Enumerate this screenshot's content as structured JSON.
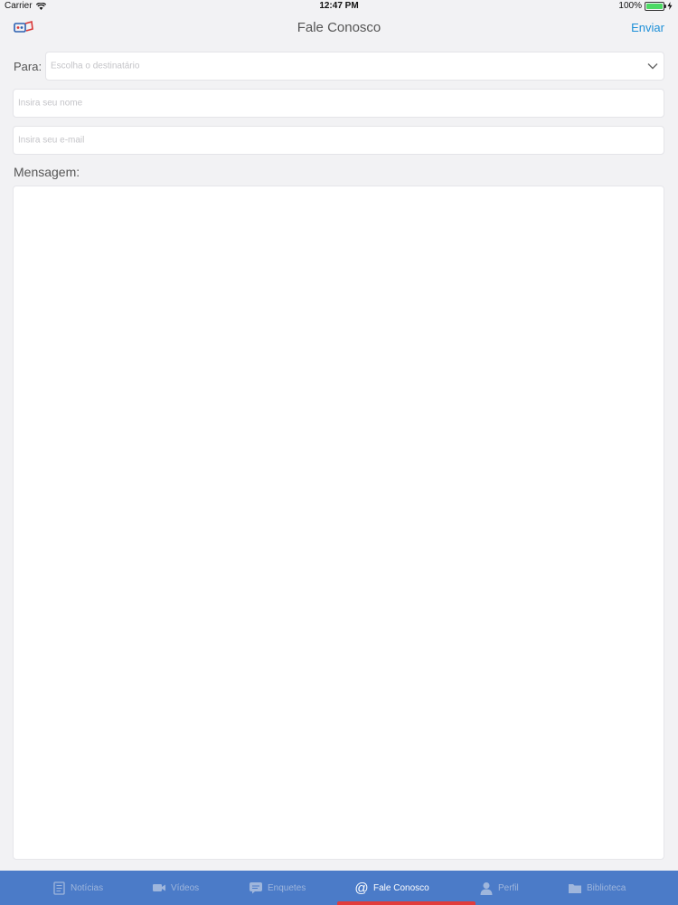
{
  "status_bar": {
    "carrier": "Carrier",
    "time": "12:47 PM",
    "battery_percent": "100%",
    "battery_level": 1.0
  },
  "nav": {
    "title": "Fale Conosco",
    "send_label": "Enviar"
  },
  "form": {
    "to_label": "Para:",
    "recipient_placeholder": "Escolha o destinatário",
    "name_placeholder": "Insira seu nome",
    "email_placeholder": "Insira seu e-mail",
    "message_label": "Mensagem:"
  },
  "tabs": [
    {
      "label": "Notícias",
      "icon": "newspaper-icon",
      "active": false
    },
    {
      "label": "Vídeos",
      "icon": "video-camera-icon",
      "active": false
    },
    {
      "label": "Enquetes",
      "icon": "chat-bubble-icon",
      "active": false
    },
    {
      "label": "Fale Conosco",
      "icon": "at-sign-icon",
      "active": true
    },
    {
      "label": "Perfil",
      "icon": "person-icon",
      "active": false
    },
    {
      "label": "Biblioteca",
      "icon": "folder-icon",
      "active": false
    }
  ],
  "colors": {
    "accent": "#1e90d8",
    "tab_bar": "#4b7bc8",
    "tab_indicator": "#e23c3c"
  }
}
